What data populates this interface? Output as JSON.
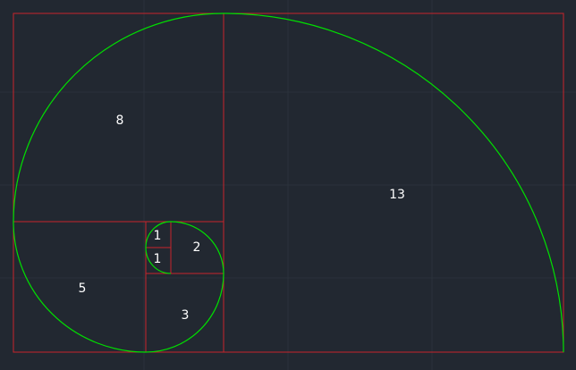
{
  "colors": {
    "background": "#222831",
    "grid": "#2a313a",
    "rectangles": "#c8242b",
    "spiral": "#00e000",
    "labels": "#ffffff"
  },
  "diagram": {
    "type": "golden-spiral",
    "squares": [
      {
        "id": "sq-13",
        "label": "13"
      },
      {
        "id": "sq-8",
        "label": "8"
      },
      {
        "id": "sq-5",
        "label": "5"
      },
      {
        "id": "sq-3",
        "label": "3"
      },
      {
        "id": "sq-2",
        "label": "2"
      },
      {
        "id": "sq-1a",
        "label": "1"
      },
      {
        "id": "sq-1b",
        "label": "1"
      }
    ]
  }
}
